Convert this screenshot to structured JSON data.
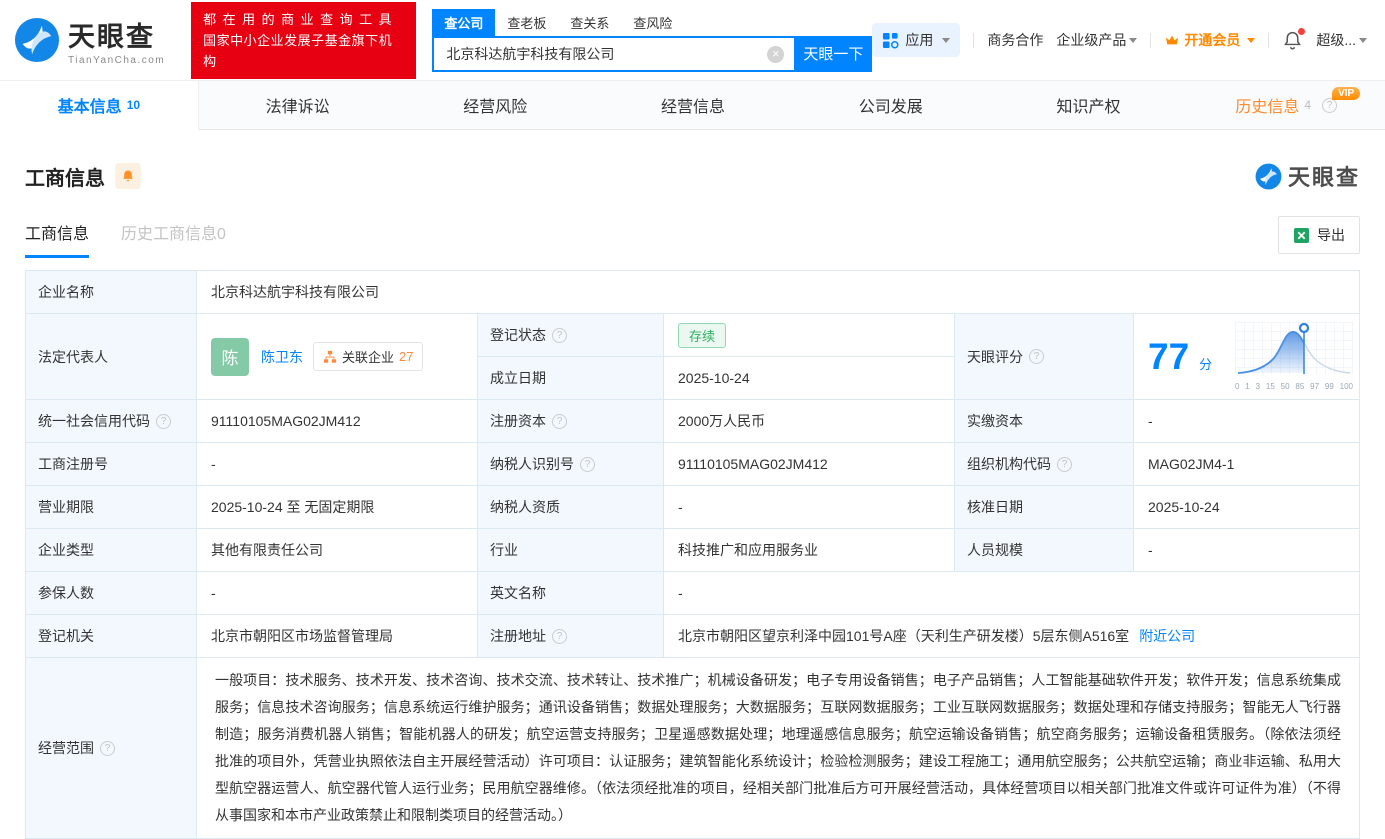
{
  "colors": {
    "primary_blue": "#0084ff",
    "brand_red": "#e60012",
    "vip_orange": "#ff8a00",
    "status_green": "#2bb05e",
    "label_cell_bg": "#f2f8fd",
    "table_border": "#dce9f2"
  },
  "header": {
    "logo": {
      "brand": "天眼查",
      "domain": "TianYanCha.com"
    },
    "slogan": {
      "line1": "都在用的商业查询工具",
      "line2": "国家中小企业发展子基金旗下机构"
    },
    "search": {
      "tabs": [
        {
          "label": "查公司",
          "active": true
        },
        {
          "label": "查老板",
          "active": false
        },
        {
          "label": "查关系",
          "active": false
        },
        {
          "label": "查风险",
          "active": false
        }
      ],
      "value": "北京科达航宇科技有限公司",
      "button": "天眼一下"
    },
    "nav": {
      "apps": "应用",
      "cooperation": "商务合作",
      "enterprise": "企业级产品",
      "vip": "开通会员",
      "user": "超级..."
    }
  },
  "tabs": [
    {
      "label": "基本信息",
      "count": "10",
      "active": true
    },
    {
      "label": "法律诉讼"
    },
    {
      "label": "经营风险"
    },
    {
      "label": "经营信息"
    },
    {
      "label": "公司发展"
    },
    {
      "label": "知识产权"
    },
    {
      "label": "历史信息",
      "count": "4",
      "badge": "VIP"
    }
  ],
  "section": {
    "title": "工商信息",
    "subtabs": [
      {
        "label": "工商信息",
        "active": true
      },
      {
        "label": "历史工商信息0",
        "active": false
      }
    ],
    "export_label": "导出",
    "watermark": "天眼查"
  },
  "company": {
    "legal_rep_name": "陈卫东",
    "legal_rep_avatar": "陈",
    "related_label": "关联企业",
    "related_count": "27"
  },
  "score": {
    "label": "天眼评分",
    "value": "77",
    "unit": "分",
    "axis_ticks": [
      "0",
      "1",
      "3",
      "15",
      "50",
      "85",
      "97",
      "99",
      "100"
    ]
  },
  "fields": {
    "company_name": {
      "label": "企业名称",
      "value": "北京科达航宇科技有限公司"
    },
    "legal_rep": {
      "label": "法定代表人"
    },
    "reg_status": {
      "label": "登记状态",
      "value": "存续"
    },
    "est_date": {
      "label": "成立日期",
      "value": "2025-10-24"
    },
    "credit_code": {
      "label": "统一社会信用代码",
      "value": "91110105MAG02JM412"
    },
    "reg_capital": {
      "label": "注册资本",
      "value": "2000万人民币"
    },
    "paid_capital": {
      "label": "实缴资本",
      "value": "-"
    },
    "reg_number": {
      "label": "工商注册号",
      "value": "-"
    },
    "taxpayer_id": {
      "label": "纳税人识别号",
      "value": "91110105MAG02JM412"
    },
    "org_code": {
      "label": "组织机构代码",
      "value": "MAG02JM4-1"
    },
    "business_term": {
      "label": "营业期限",
      "value": "2025-10-24 至 无固定期限"
    },
    "taxpayer_quality": {
      "label": "纳税人资质",
      "value": "-"
    },
    "approval_date": {
      "label": "核准日期",
      "value": "2025-10-24"
    },
    "company_type": {
      "label": "企业类型",
      "value": "其他有限责任公司"
    },
    "industry": {
      "label": "行业",
      "value": "科技推广和应用服务业"
    },
    "staff_size": {
      "label": "人员规模",
      "value": "-"
    },
    "insured_count": {
      "label": "参保人数",
      "value": "-"
    },
    "english_name": {
      "label": "英文名称",
      "value": "-"
    },
    "reg_authority": {
      "label": "登记机关",
      "value": "北京市朝阳区市场监督管理局"
    },
    "reg_address": {
      "label": "注册地址",
      "value": "北京市朝阳区望京利泽中园101号A座（天利生产研发楼）5层东侧A516室",
      "link": "附近公司"
    },
    "business_scope": {
      "label": "经营范围",
      "value": "一般项目：技术服务、技术开发、技术咨询、技术交流、技术转让、技术推广；机械设备研发；电子专用设备销售；电子产品销售；人工智能基础软件开发；软件开发；信息系统集成服务；信息技术咨询服务；信息系统运行维护服务；通讯设备销售；数据处理服务；大数据服务；互联网数据服务；工业互联网数据服务；数据处理和存储支持服务；智能无人飞行器制造；服务消费机器人销售；智能机器人的研发；航空运营支持服务；卫星遥感数据处理；地理遥感信息服务；航空运输设备销售；航空商务服务；运输设备租赁服务。（除依法须经批准的项目外，凭营业执照依法自主开展经营活动）许可项目：认证服务；建筑智能化系统设计；检验检测服务；建设工程施工；通用航空服务；公共航空运输；商业非运输、私用大型航空器运营人、航空器代管人运行业务；民用航空器维修。（依法须经批准的项目，经相关部门批准后方可开展经营活动，具体经营项目以相关部门批准文件或许可证件为准）（不得从事国家和本市产业政策禁止和限制类项目的经营活动。）"
    }
  }
}
